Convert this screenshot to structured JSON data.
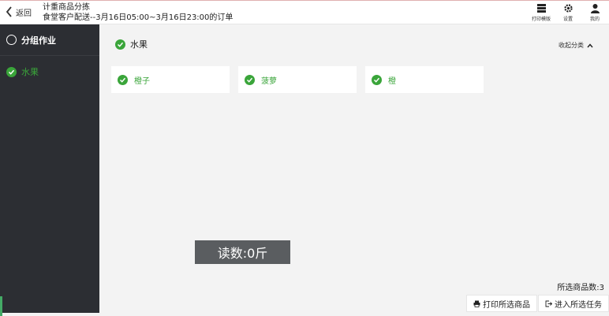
{
  "header": {
    "back_label": "返回",
    "title": "计重商品分拣",
    "subtitle": "食堂客户配送--3月16日05:00~3月16日23:00的订单",
    "actions": [
      {
        "icon": "print-template-icon",
        "label": "打印模版"
      },
      {
        "icon": "gear-icon",
        "label": "设置"
      },
      {
        "icon": "user-icon",
        "label": "我的"
      }
    ]
  },
  "sidebar": {
    "items": [
      {
        "label": "分组作业",
        "state": "unchecked"
      },
      {
        "label": "水果",
        "state": "checked"
      }
    ]
  },
  "category": {
    "name": "水果",
    "collapse_label": "收起分类"
  },
  "products": [
    {
      "label": "橙子"
    },
    {
      "label": "菠萝"
    },
    {
      "label": "橙"
    }
  ],
  "reading": "读数:0斤",
  "selected_count": "所选商品数:3",
  "buttons": {
    "print_selected": "打印所选商品",
    "enter_task": "进入所选任务"
  },
  "colors": {
    "accent": "#3aa53a",
    "sidebar_bg": "#2c2e33",
    "reading_bg": "#5a5d60"
  }
}
